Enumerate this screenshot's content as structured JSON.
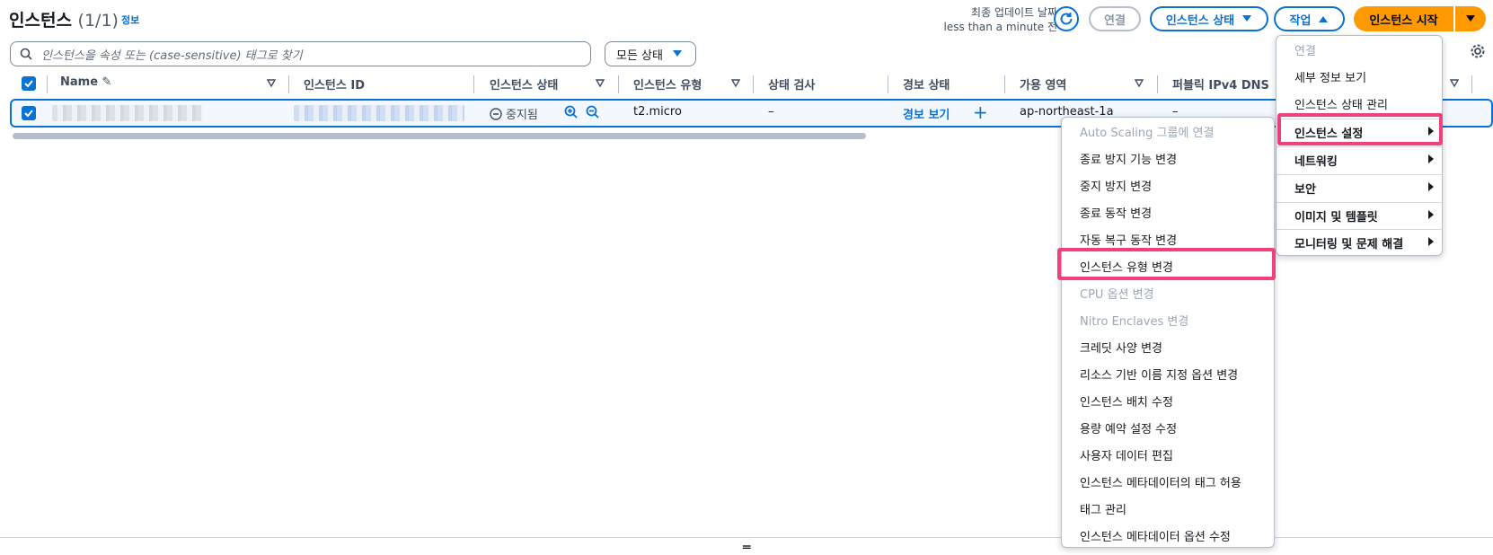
{
  "header": {
    "title": "인스턴스",
    "count": "(1/1)",
    "info": "정보",
    "last_updated_label": "최종 업데이트 날짜",
    "last_updated_value": "less than a minute 전"
  },
  "toolbar": {
    "connect": "연결",
    "instance_state": "인스턴스 상태",
    "actions": "작업",
    "start_instance": "인스턴스 시작"
  },
  "search": {
    "placeholder": "인스턴스을 속성 또는 (case-sensitive) 태그로 찾기"
  },
  "filter": {
    "label": "모든 상태"
  },
  "table": {
    "columns": [
      "Name",
      "인스턴스 ID",
      "인스턴스 상태",
      "인스턴스 유형",
      "상태 검사",
      "경보 상태",
      "가용 영역",
      "퍼블릭 IPv4 DNS"
    ],
    "row": {
      "state": "중지됨",
      "type": "t2.micro",
      "status_check": "–",
      "alarm": "경보 보기",
      "az": "ap-northeast-1a",
      "dns": "–"
    }
  },
  "actions_menu": {
    "items": [
      "연결",
      "세부 정보 보기",
      "인스턴스 상태 관리",
      "인스턴스 설정",
      "네트워킹",
      "보안",
      "이미지 및 템플릿",
      "모니터링 및 문제 해결"
    ],
    "disabled": [
      "연결"
    ],
    "highlighted": "인스턴스 설정"
  },
  "settings_submenu": {
    "items": [
      "Auto Scaling 그룹에 연결",
      "종료 방지 기능 변경",
      "중지 방지 변경",
      "종료 동작 변경",
      "자동 복구 동작 변경",
      "인스턴스 유형 변경",
      "CPU 옵션 변경",
      "Nitro Enclaves 변경",
      "크레딧 사양 변경",
      "리소스 기반 이름 지정 옵션 변경",
      "인스턴스 배치 수정",
      "용량 예약 설정 수정",
      "사용자 데이터 편집",
      "인스턴스 메타데이터의 태그 허용",
      "태그 관리",
      "인스턴스 메타데이터 옵션 수정"
    ],
    "disabled": [
      "Auto Scaling 그룹에 연결",
      "CPU 옵션 변경",
      "Nitro Enclaves 변경"
    ],
    "highlighted": "인스턴스 유형 변경"
  },
  "colors": {
    "accent": "#0972d3",
    "primary": "#ff9900",
    "highlight": "#f0417a"
  }
}
